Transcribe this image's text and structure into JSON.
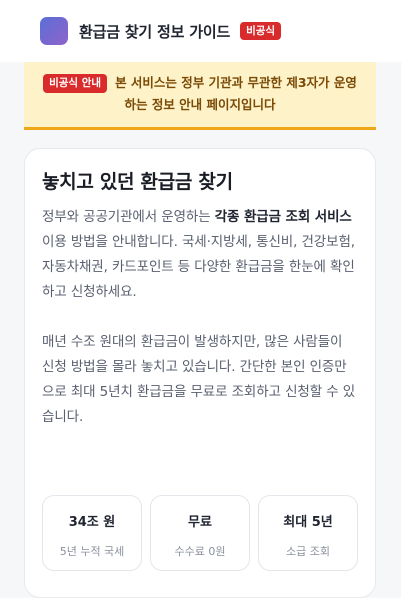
{
  "header": {
    "title": "환급금 찾기 정보 가이드",
    "badge": "비공식"
  },
  "notice": {
    "badge": "비공식 안내",
    "text": "본 서비스는 정부 기관과 무관한 제3자가 운영하는 정보 안내 페이지입니다"
  },
  "card": {
    "title": "놓치고 있던 환급금 찾기",
    "p1_pre": "정부와 공공기관에서 운영하는 ",
    "p1_bold": "각종 환급금 조회 서비스",
    "p1_post": " 이용 방법을 안내합니다. 국세·지방세, 통신비, 건강보험, 자동차채권, 카드포인트 등 다양한 환급금을 한눈에 확인하고 신청하세요.",
    "p2": "매년 수조 원대의 환급금이 발생하지만, 많은 사람들이 신청 방법을 몰라 놓치고 있습니다. 간단한 본인 인증만으로 최대 5년치 환급금을 무료로 조회하고 신청할 수 있습니다."
  },
  "stats": [
    {
      "value": "34조 원",
      "label": "5년 누적 국세"
    },
    {
      "value": "무료",
      "label": "수수료 0원"
    },
    {
      "value": "최대 5년",
      "label": "소급 조회"
    }
  ],
  "colors": {
    "badge": "#d92b2b",
    "notice_bg": "#fdf2c8",
    "notice_border": "#efa71a",
    "notice_text": "#7a4a06"
  }
}
